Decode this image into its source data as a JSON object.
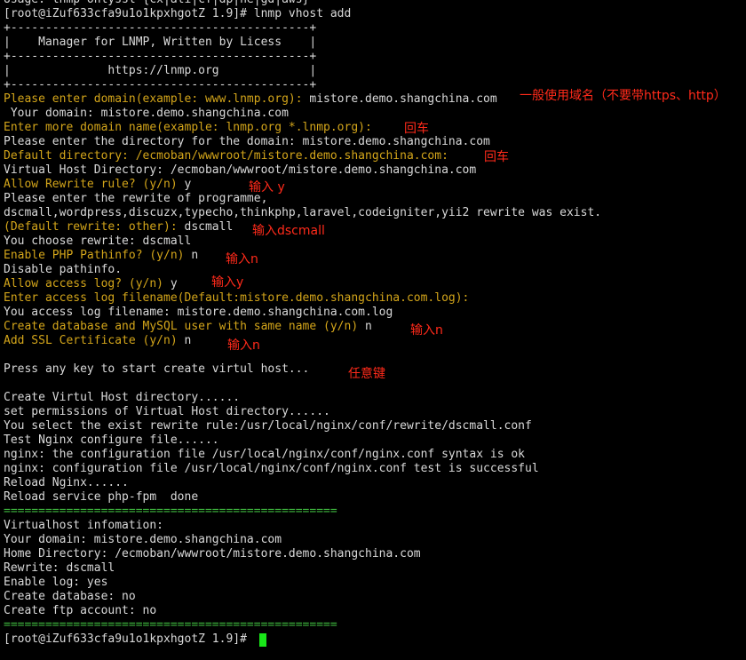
{
  "colors": {
    "background": "#000000",
    "text": "#d9d9d9",
    "prompt_yellow": "#d3a51a",
    "separator_green": "#3fb93f",
    "annotation_red": "#ff2a1a",
    "cursor_green": "#19e619"
  },
  "lines": [
    {
      "text": "Usage: lnmp onlyssl {cx|ali|cf|dp|he|gd|aws}"
    },
    {
      "text": "[root@iZuf633cfa9u1o1kpxhgotZ 1.9]# lnmp vhost add"
    },
    {
      "text": "+-------------------------------------------+"
    },
    {
      "text": "|    Manager for LNMP, Written by Licess    |"
    },
    {
      "text": "+-------------------------------------------+"
    },
    {
      "text": "|              https://lnmp.org             |"
    },
    {
      "text": "+-------------------------------------------+"
    },
    {
      "prompt": "Please enter domain(example: www.lnmp.org): ",
      "answer": "mistore.demo.shangchina.com"
    },
    {
      "text": " Your domain: mistore.demo.shangchina.com"
    },
    {
      "prompt": "Enter more domain name(example: lnmp.org *.lnmp.org): ",
      "answer": ""
    },
    {
      "text": "Please enter the directory for the domain: mistore.demo.shangchina.com"
    },
    {
      "prompt": "Default directory: /ecmoban/wwwroot/mistore.demo.shangchina.com: ",
      "answer": ""
    },
    {
      "text": "Virtual Host Directory: /ecmoban/wwwroot/mistore.demo.shangchina.com"
    },
    {
      "prompt": "Allow Rewrite rule? (y/n) ",
      "answer": "y"
    },
    {
      "text": "Please enter the rewrite of programme,"
    },
    {
      "text": "dscmall,wordpress,discuzx,typecho,thinkphp,laravel,codeigniter,yii2 rewrite was exist."
    },
    {
      "prompt": "(Default rewrite: other): ",
      "answer": "dscmall"
    },
    {
      "text": "You choose rewrite: dscmall"
    },
    {
      "prompt": "Enable PHP Pathinfo? (y/n) ",
      "answer": "n"
    },
    {
      "text": "Disable pathinfo."
    },
    {
      "prompt": "Allow access log? (y/n) ",
      "answer": "y"
    },
    {
      "prompt": "Enter access log filename(Default:mistore.demo.shangchina.com.log): ",
      "answer": ""
    },
    {
      "text": "You access log filename: mistore.demo.shangchina.com.log"
    },
    {
      "prompt": "Create database and MySQL user with same name (y/n) ",
      "answer": "n"
    },
    {
      "prompt": "Add SSL Certificate (y/n) ",
      "answer": "n"
    },
    {
      "text": ""
    },
    {
      "text": "Press any key to start create virtul host..."
    },
    {
      "text": ""
    },
    {
      "text": "Create Virtul Host directory......"
    },
    {
      "text": "set permissions of Virtual Host directory......"
    },
    {
      "text": "You select the exist rewrite rule:/usr/local/nginx/conf/rewrite/dscmall.conf"
    },
    {
      "text": "Test Nginx configure file......"
    },
    {
      "text": "nginx: the configuration file /usr/local/nginx/conf/nginx.conf syntax is ok"
    },
    {
      "text": "nginx: configuration file /usr/local/nginx/conf/nginx.conf test is successful"
    },
    {
      "text": "Reload Nginx......"
    },
    {
      "text": "Reload service php-fpm  done"
    },
    {
      "separator": "================================================"
    },
    {
      "text": "Virtualhost infomation:"
    },
    {
      "text": "Your domain: mistore.demo.shangchina.com"
    },
    {
      "text": "Home Directory: /ecmoban/wwwroot/mistore.demo.shangchina.com"
    },
    {
      "text": "Rewrite: dscmall"
    },
    {
      "text": "Enable log: yes"
    },
    {
      "text": "Create database: no"
    },
    {
      "text": "Create ftp account: no"
    },
    {
      "separator": "================================================"
    },
    {
      "text": "[root@iZuf633cfa9u1o1kpxhgotZ 1.9]# "
    }
  ],
  "annotations": [
    {
      "text": "一般使用域名（不要带https、http）",
      "line": 7
    },
    {
      "text": "回车",
      "line": 9
    },
    {
      "text": "回车",
      "line": 11
    },
    {
      "text": "输入 y",
      "line": 13
    },
    {
      "text": "输入dscmall",
      "line": 16
    },
    {
      "text": "输入n",
      "line": 18
    },
    {
      "text": "输入y",
      "line": 20
    },
    {
      "text": "输入n",
      "line": 23
    },
    {
      "text": "输入n",
      "line": 24
    },
    {
      "text": "任意键",
      "line": 26
    }
  ]
}
